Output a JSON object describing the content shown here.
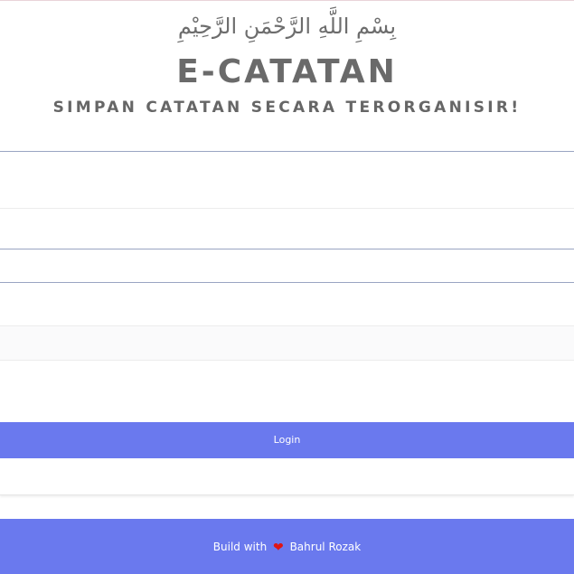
{
  "header": {
    "basmala": "بِسْمِ اللَّهِ الرَّحْمَنِ الرَّحِيْمِ",
    "title": "E-CATATAN",
    "tagline": "SIMPAN CATATAN SECARA TERORGANISIR!"
  },
  "form": {
    "login_label": "Login"
  },
  "footer": {
    "build_prefix": "Build with",
    "author": "Bahrul Rozak"
  },
  "colors": {
    "accent": "#6a79ee",
    "heart": "#e01414",
    "title_text": "#6a6a6a"
  },
  "icons": {
    "heart": "heart-icon"
  }
}
